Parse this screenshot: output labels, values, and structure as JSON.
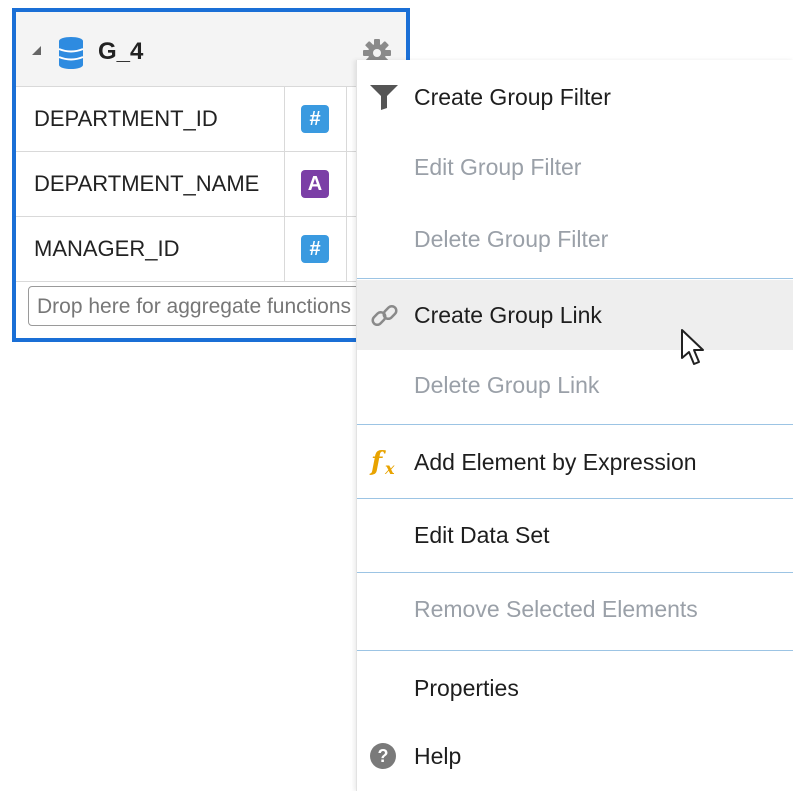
{
  "group": {
    "title": "G_4",
    "fields": [
      {
        "name": "DEPARTMENT_ID",
        "type_icon": "number-type-icon",
        "glyph": "#"
      },
      {
        "name": "DEPARTMENT_NAME",
        "type_icon": "text-type-icon",
        "glyph": "A"
      },
      {
        "name": "MANAGER_ID",
        "type_icon": "number-type-icon",
        "glyph": "#"
      }
    ],
    "drop_placeholder": "Drop here for aggregate functions",
    "border_color": "#1a6fd6"
  },
  "menu": {
    "items": [
      {
        "label": "Create Group Filter",
        "enabled": true,
        "icon": "filter-icon"
      },
      {
        "label": "Edit Group Filter",
        "enabled": false
      },
      {
        "label": "Delete Group Filter",
        "enabled": false
      },
      {
        "label": "Create Group Link",
        "enabled": true,
        "icon": "link-icon",
        "hovered": true
      },
      {
        "label": "Delete Group Link",
        "enabled": false
      },
      {
        "label": "Add Element by Expression",
        "enabled": true,
        "icon": "function-icon"
      },
      {
        "label": "Edit Data Set",
        "enabled": true
      },
      {
        "label": "Remove Selected Elements",
        "enabled": false
      },
      {
        "label": "Properties",
        "enabled": true
      },
      {
        "label": "Help",
        "enabled": true,
        "icon": "help-icon"
      }
    ]
  }
}
